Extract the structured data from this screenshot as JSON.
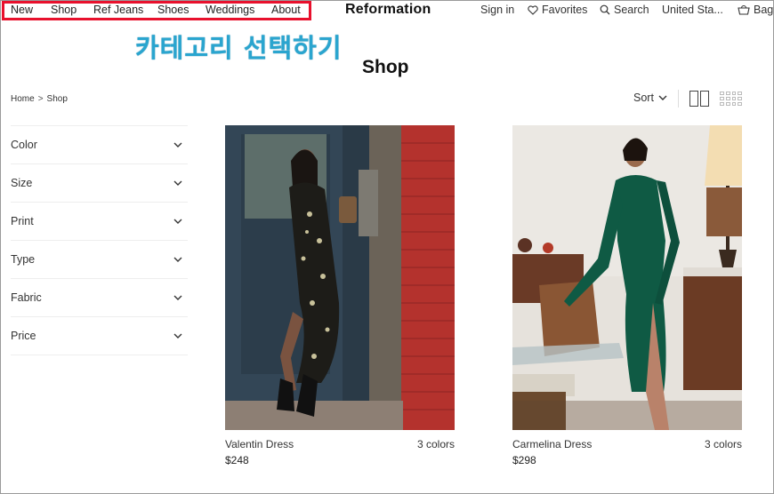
{
  "nav": {
    "left": [
      "New",
      "Shop",
      "Ref Jeans",
      "Shoes",
      "Weddings",
      "About"
    ],
    "brand": "Reformation",
    "sign_in": "Sign in",
    "favorites": "Favorites",
    "search": "Search",
    "region": "United Sta...",
    "bag": "Bag"
  },
  "annotation": "카테고리 선택하기",
  "page_title": "Shop",
  "breadcrumb": [
    "Home",
    "Shop"
  ],
  "breadcrumb_sep": ">",
  "sort_label": "Sort",
  "filters": [
    "Color",
    "Size",
    "Print",
    "Type",
    "Fabric",
    "Price"
  ],
  "products": [
    {
      "name": "Valentin Dress",
      "colors": "3 colors",
      "price": "$248"
    },
    {
      "name": "Carmelina Dress",
      "colors": "3 colors",
      "price": "$298"
    }
  ],
  "colors": {
    "highlight": "#e8112d",
    "annotation": "#2aa5cf"
  }
}
